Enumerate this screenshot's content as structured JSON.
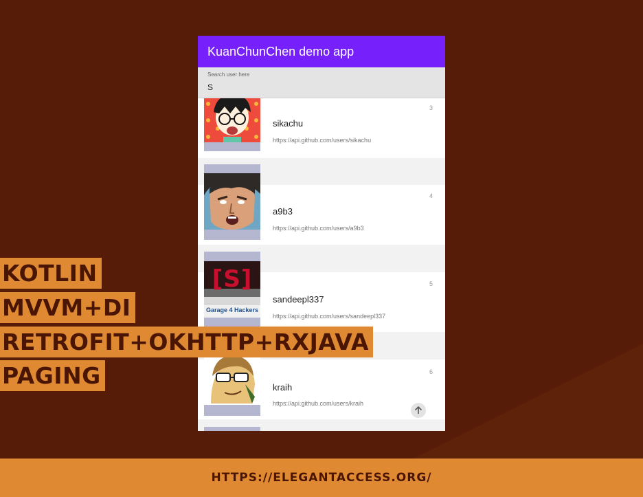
{
  "app": {
    "title": "KuanChunChen demo app"
  },
  "search": {
    "label": "Search user here",
    "value": "S"
  },
  "users": [
    {
      "name": "sikachu",
      "url": "https://api.github.com/users/sikachu",
      "index": "3",
      "avatar": "cartoon-glasses-avatar"
    },
    {
      "name": "a9b3",
      "url": "https://api.github.com/users/a9b3",
      "index": "4",
      "avatar": "anime-man-avatar"
    },
    {
      "name": "sandeepl337",
      "url": "https://api.github.com/users/sandeepl337",
      "index": "5",
      "avatar": "garage4hackers-logo-avatar",
      "avatar_text": "Garage 4 Hackers",
      "avatar_logo": "[S]"
    },
    {
      "name": "kraih",
      "url": "https://api.github.com/users/kraih",
      "index": "6",
      "avatar": "cartoon-sunglasses-avatar"
    }
  ],
  "fab": {
    "icon": "arrow-up-icon"
  },
  "tags": [
    "KOTLIN",
    "MVVM+DI",
    "RETROFIT+OKHTTP+RXJAVA",
    "PAGING"
  ],
  "footer": {
    "url": "HTTPS://ELEGANTACCESS.ORG/"
  },
  "colors": {
    "background": "#561c07",
    "accent": "#df8a33",
    "appbar": "#7621fb"
  }
}
